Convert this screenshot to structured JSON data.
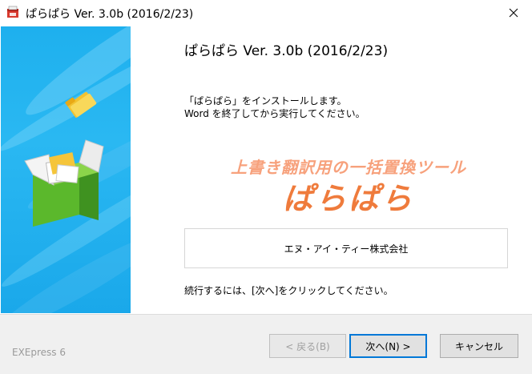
{
  "window": {
    "title": "ぱらぱら Ver. 3.0b (2016/2/23)",
    "close_glyph": "✕"
  },
  "content": {
    "heading": "ぱらぱら Ver. 3.0b (2016/2/23)",
    "intro_line1": "「ぱらぱら」をインストールします。",
    "intro_line2": "Word を終了してから実行してください。",
    "logo_tagline": "上書き翻訳用の一括置換ツール",
    "logo_product": "ぱらぱら",
    "company": "エヌ・アイ・ティー株式会社",
    "continue_text": "続行するには、[次へ]をクリックしてください。"
  },
  "footer": {
    "brand": "EXEpress 6",
    "back_label": "< 戻る(B)",
    "next_label": "次へ(N) >",
    "cancel_label": "キャンセル"
  },
  "colors": {
    "banner": "#1eb0ee",
    "logo_tagline": "#f7a17c",
    "logo_product": "#ef7b3c",
    "default_button_border": "#0078d7"
  },
  "icons": {
    "app": "installer-app-icon",
    "close": "close-icon",
    "banner": "package-box-icon"
  }
}
